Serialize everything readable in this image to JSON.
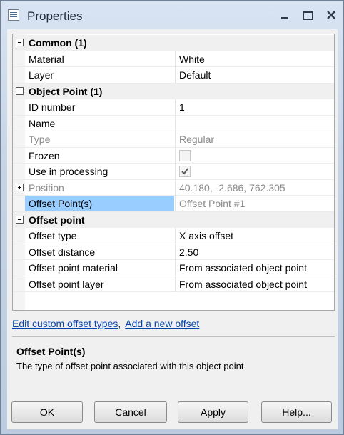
{
  "window": {
    "title": "Properties"
  },
  "grid": {
    "sections": [
      {
        "title": "Common (1)",
        "rows": [
          {
            "label": "Material",
            "value": "White"
          },
          {
            "label": "Layer",
            "value": "Default"
          }
        ]
      },
      {
        "title": "Object Point (1)",
        "rows": [
          {
            "label": "ID number",
            "value": "1"
          },
          {
            "label": "Name",
            "value": ""
          },
          {
            "label": "Type",
            "value": "Regular"
          },
          {
            "label": "Frozen",
            "checked": false
          },
          {
            "label": "Use in processing",
            "checked": true
          },
          {
            "label": "Position",
            "value": "40.180, -2.686, 762.305"
          },
          {
            "label": "Offset Point(s)",
            "value": "Offset Point #1"
          }
        ]
      },
      {
        "title": "Offset point",
        "rows": [
          {
            "label": "Offset type",
            "value": "X axis offset"
          },
          {
            "label": "Offset distance",
            "value": "2.50"
          },
          {
            "label": "Offset point material",
            "value": "From associated object point"
          },
          {
            "label": "Offset point layer",
            "value": "From associated object point"
          }
        ]
      }
    ]
  },
  "links": {
    "edit_custom": "Edit custom offset types",
    "separator": ",",
    "add_offset": "Add a new offset"
  },
  "description": {
    "title": "Offset Point(s)",
    "text": "The type of offset point associated with this object point"
  },
  "buttons": {
    "ok": "OK",
    "cancel": "Cancel",
    "apply": "Apply",
    "help": "Help..."
  }
}
